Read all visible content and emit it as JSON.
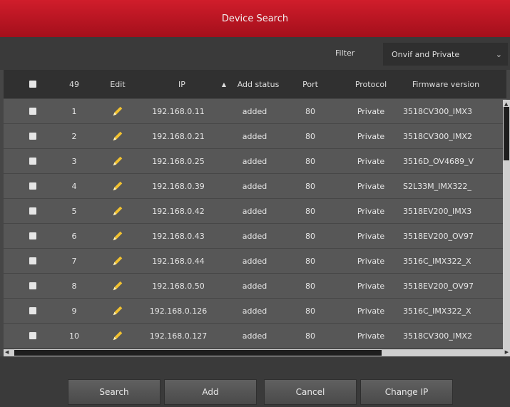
{
  "title": "Device Search",
  "filter": {
    "label": "Filter",
    "value": "Onvif and Private"
  },
  "table": {
    "count_header": "49",
    "headers": {
      "edit": "Edit",
      "ip": "IP",
      "add_status": "Add status",
      "port": "Port",
      "protocol": "Protocol",
      "firmware": "Firmware version"
    },
    "rows": [
      {
        "no": "1",
        "ip": "192.168.0.11",
        "status": "added",
        "port": "80",
        "protocol": "Private",
        "firmware": "3518CV300_IMX3"
      },
      {
        "no": "2",
        "ip": "192.168.0.21",
        "status": "added",
        "port": "80",
        "protocol": "Private",
        "firmware": "3518CV300_IMX2"
      },
      {
        "no": "3",
        "ip": "192.168.0.25",
        "status": "added",
        "port": "80",
        "protocol": "Private",
        "firmware": "3516D_OV4689_V"
      },
      {
        "no": "4",
        "ip": "192.168.0.39",
        "status": "added",
        "port": "80",
        "protocol": "Private",
        "firmware": "S2L33M_IMX322_"
      },
      {
        "no": "5",
        "ip": "192.168.0.42",
        "status": "added",
        "port": "80",
        "protocol": "Private",
        "firmware": "3518EV200_IMX3"
      },
      {
        "no": "6",
        "ip": "192.168.0.43",
        "status": "added",
        "port": "80",
        "protocol": "Private",
        "firmware": "3518EV200_OV97"
      },
      {
        "no": "7",
        "ip": "192.168.0.44",
        "status": "added",
        "port": "80",
        "protocol": "Private",
        "firmware": "3516C_IMX322_X"
      },
      {
        "no": "8",
        "ip": "192.168.0.50",
        "status": "added",
        "port": "80",
        "protocol": "Private",
        "firmware": "3518EV200_OV97"
      },
      {
        "no": "9",
        "ip": "192.168.0.126",
        "status": "added",
        "port": "80",
        "protocol": "Private",
        "firmware": "3516C_IMX322_X"
      },
      {
        "no": "10",
        "ip": "192.168.0.127",
        "status": "added",
        "port": "80",
        "protocol": "Private",
        "firmware": "3518CV300_IMX2"
      }
    ]
  },
  "buttons": {
    "search": "Search",
    "add": "Add",
    "cancel": "Cancel",
    "change_ip": "Change IP"
  },
  "colors": {
    "title_bar": "#c8182a",
    "row_bg": "#575757",
    "pencil": "#f2c230"
  }
}
